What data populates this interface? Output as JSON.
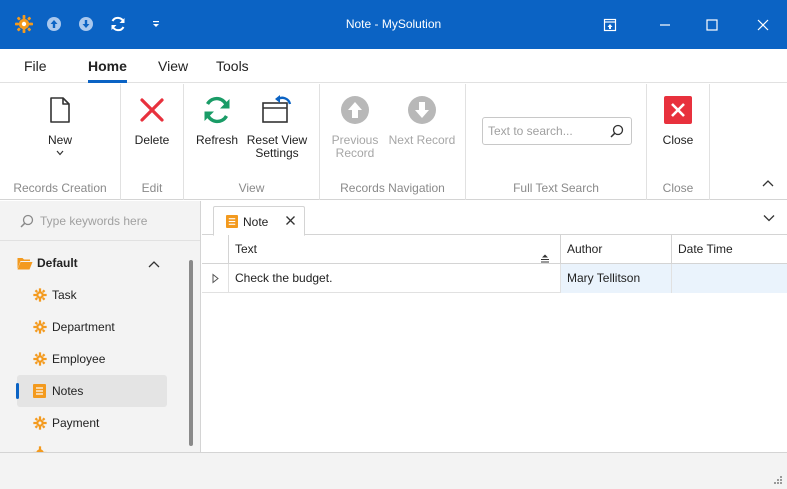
{
  "window": {
    "title": "Note - MySolution"
  },
  "menu": {
    "tabs": [
      "File",
      "Home",
      "View",
      "Tools"
    ],
    "active": "Home"
  },
  "ribbon": {
    "groups": {
      "records_creation": "Records Creation",
      "edit": "Edit",
      "view": "View",
      "records_navigation": "Records Navigation",
      "full_text_search": "Full Text Search",
      "close": "Close"
    },
    "buttons": {
      "new": "New",
      "delete": "Delete",
      "refresh": "Refresh",
      "reset_view_line1": "Reset View",
      "reset_view_line2": "Settings",
      "previous_line1": "Previous",
      "previous_line2": "Record",
      "next_record": "Next Record",
      "close": "Close"
    },
    "search": {
      "placeholder": "Text to search...",
      "value": ""
    }
  },
  "navigation": {
    "search_placeholder": "Type keywords here",
    "group_label": "Default",
    "items": [
      "Task",
      "Department",
      "Employee",
      "Notes",
      "Payment"
    ],
    "selected": "Notes"
  },
  "document": {
    "tab_label": "Note"
  },
  "grid": {
    "columns": [
      "Text",
      "Author",
      "Date Time"
    ],
    "rows": [
      {
        "text": "Check the budget.",
        "author": "Mary Tellitson",
        "date_time": ""
      }
    ]
  },
  "colors": {
    "accent": "#0b63c4",
    "delete_red": "#e8313d",
    "refresh_green": "#1a9c67",
    "nav_icon_orange": "#f39a1e",
    "close_red": "#e8313d"
  }
}
